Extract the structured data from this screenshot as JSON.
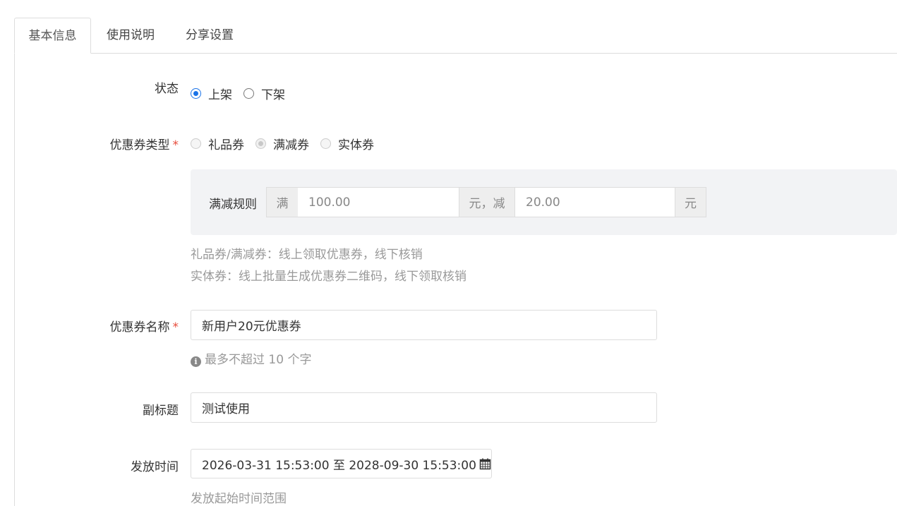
{
  "tabs": [
    {
      "label": "基本信息",
      "active": true
    },
    {
      "label": "使用说明",
      "active": false
    },
    {
      "label": "分享设置",
      "active": false
    }
  ],
  "status": {
    "label": "状态",
    "options": [
      {
        "label": "上架",
        "checked": true
      },
      {
        "label": "下架",
        "checked": false
      }
    ]
  },
  "coupon_type": {
    "label": "优惠券类型",
    "required_mark": "*",
    "options": [
      {
        "label": "礼品券",
        "checked": false,
        "disabled": true
      },
      {
        "label": "满减券",
        "checked": true,
        "disabled": true
      },
      {
        "label": "实体券",
        "checked": false,
        "disabled": true
      }
    ]
  },
  "discount_rule": {
    "label": "满减规则",
    "prefix": "满",
    "threshold_value": "100.00",
    "middle": "元，减",
    "discount_value": "20.00",
    "suffix": "元"
  },
  "type_help": [
    "礼品券/满减券：线上领取优惠券，线下核销",
    "实体券：线上批量生成优惠券二维码，线下领取核销"
  ],
  "coupon_name": {
    "label": "优惠券名称",
    "required_mark": "*",
    "value": "新用户20元优惠券",
    "help": "最多不超过 10 个字"
  },
  "subtitle": {
    "label": "副标题",
    "value": "测试使用"
  },
  "issue_time": {
    "label": "发放时间",
    "value": "2026-03-31 15:53:00 至 2028-09-30 15:53:00",
    "help": "发放起始时间范围"
  },
  "icons": {
    "info": "info-circle-icon",
    "calendar": "calendar-icon"
  },
  "colors": {
    "accent": "#1a73e8",
    "required": "#e74c3c",
    "help_text": "#999999"
  }
}
